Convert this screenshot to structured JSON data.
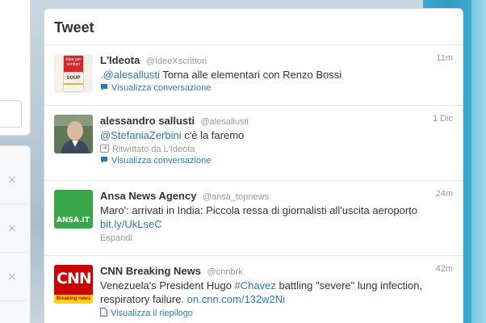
{
  "panel": {
    "title": "Tweet"
  },
  "left": {
    "close_glyph": "×"
  },
  "tweets": [
    {
      "name": "L'Ideota",
      "handle": "@IdeeXscrittori",
      "time": "11m",
      "text_parts": [
        ".@alesallusti",
        " Torna alle elementari con Renzo Bossi"
      ],
      "action": "Visualizza conversazione",
      "avatar_icon": "soup-can-avatar",
      "avatar_text": {
        "top": "Idee per scrittori",
        "bottom": "SOUP"
      }
    },
    {
      "name": "alessandro sallusti",
      "handle": "@alesallusti",
      "time": "1 Dic",
      "text_parts": [
        "@StefaniaZerbini",
        " c'è la faremo"
      ],
      "retweet": "Ritwittato da L'Ideota",
      "action": "Visualizza conversazione",
      "avatar_icon": "person-photo-avatar"
    },
    {
      "name": "Ansa News Agency",
      "handle": "@ansa_topnews",
      "time": "24m",
      "text": "Maro': arrivati in India: Piccola ressa di giornalisti all'uscita aeroporto",
      "link": "bit.ly/UkLseC",
      "action": "Espandi",
      "avatar_text": "ANSA.IT"
    },
    {
      "name": "CNN Breaking News",
      "handle": "@cnnbrk",
      "time": "42m",
      "text_parts": [
        "Venezuela's President Hugo ",
        "#Chavez",
        " battling \"severe\" lung infection,",
        "respiratory failure. ",
        "on.cnn.com/132w2Ni"
      ],
      "action": "Visualizza il riepilogo",
      "avatar_text": {
        "logo": "CNN",
        "band": "Breaking news"
      }
    }
  ],
  "colors": {
    "link": "#2b7bb9",
    "ansa_green": "#3aa64a",
    "cnn_red": "#cc0000",
    "accent_blue": "#2f9bc2"
  }
}
